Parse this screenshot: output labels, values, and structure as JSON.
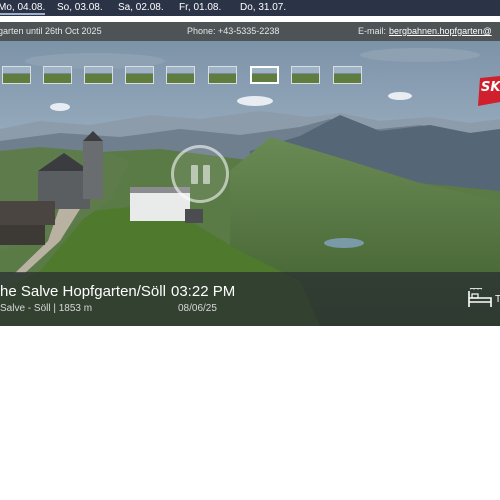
{
  "date_strip": {
    "days": [
      "Mo, 04.08.",
      "So, 03.08.",
      "Sa, 02.08.",
      "Fr, 01.08.",
      "Do, 31.07."
    ]
  },
  "info_bar": {
    "season_text": "garten until 26th Oct 2025",
    "phone_text": "Phone: +43-5335-2238",
    "email_label": "E-mail:",
    "email_link": "bergbahnen.hopfgarten@"
  },
  "thumbnails": {
    "count": 9,
    "active_index": 6
  },
  "player": {
    "state_icon": "pause-icon"
  },
  "logo": {
    "letters": "SK"
  },
  "caption": {
    "title": "he Salve Hopfgarten/Söll",
    "subtitle": "Salve - Söll | 1853 m",
    "time": "03:22 PM",
    "date": "08/06/25",
    "more_label": "T"
  },
  "colors": {
    "date_strip_bg": "#2b3346",
    "info_bar_bg": "#4e5356",
    "caption_bg": "#282d32",
    "logo_red": "#d0202e"
  }
}
